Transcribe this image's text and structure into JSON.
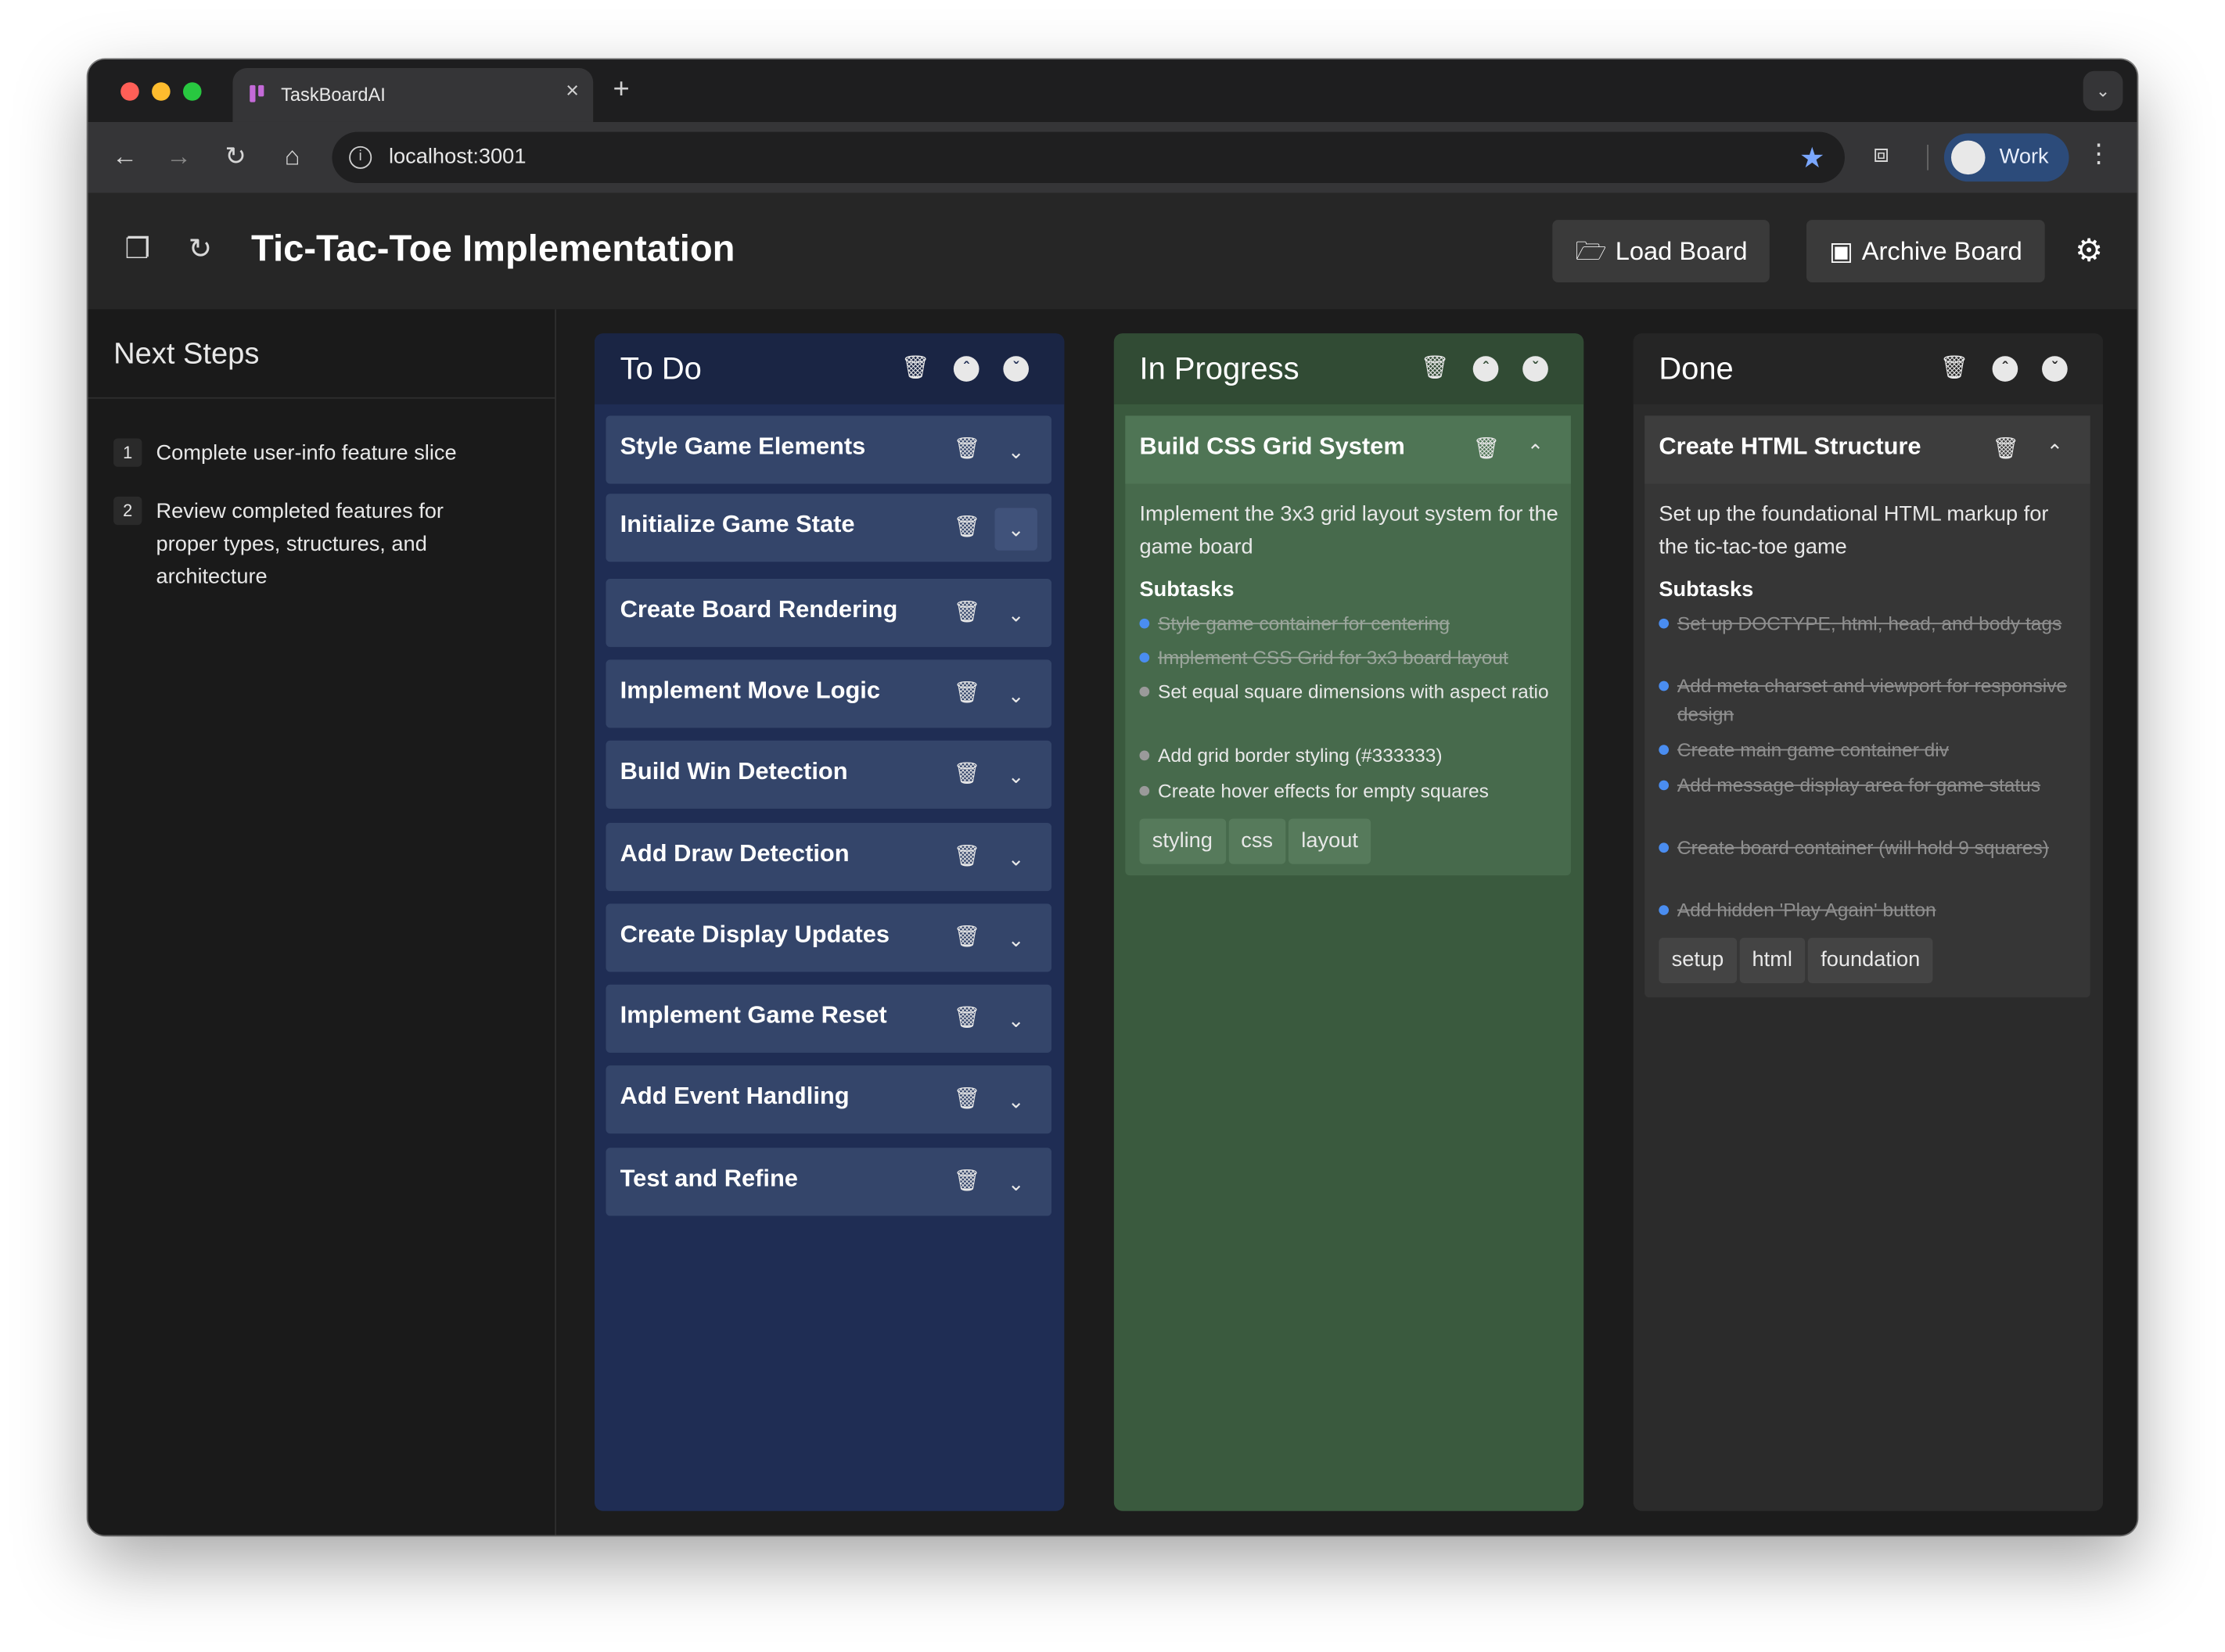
{
  "browser": {
    "tab_title": "TaskBoardAI",
    "new_tab": "+",
    "tab_close": "×",
    "url": "localhost:3001",
    "profile_label": "Work"
  },
  "app": {
    "board_title": "Tic-Tac-Toe Implementation",
    "load_board_label": "Load Board",
    "archive_board_label": "Archive Board"
  },
  "sidebar": {
    "title": "Next Steps",
    "steps": [
      {
        "num": "1",
        "text": "Complete user-info feature slice"
      },
      {
        "num": "2",
        "text": "Review completed features for proper types, structures, and architecture"
      }
    ]
  },
  "columns": {
    "todo": {
      "title": "To Do",
      "cards": [
        "Style Game Elements",
        "Initialize Game State",
        "Create Board Rendering",
        "Implement Move Logic",
        "Build Win Detection",
        "Add Draw Detection",
        "Create Display Updates",
        "Implement Game Reset",
        "Add Event Handling",
        "Test and Refine"
      ]
    },
    "in_progress": {
      "title": "In Progress",
      "card": {
        "title": "Build CSS Grid System",
        "description": "Implement the 3x3 grid layout system for the game board",
        "subtasks_label": "Subtasks",
        "subtasks": [
          {
            "text": "Style game container for centering",
            "done": true
          },
          {
            "text": "Implement CSS Grid for 3x3 board layout",
            "done": true
          },
          {
            "text": "Set equal square dimensions with aspect ratio",
            "done": false
          },
          {
            "text": "Add grid border styling (#333333)",
            "done": false
          },
          {
            "text": "Create hover effects for empty squares",
            "done": false
          }
        ],
        "tags": [
          "styling",
          "css",
          "layout"
        ]
      }
    },
    "done": {
      "title": "Done",
      "card": {
        "title": "Create HTML Structure",
        "description": "Set up the foundational HTML markup for the tic-tac-toe game",
        "subtasks_label": "Subtasks",
        "subtasks": [
          {
            "text": "Set up DOCTYPE, html, head, and body tags",
            "done": true
          },
          {
            "text": "Add meta charset and viewport for responsive design",
            "done": true
          },
          {
            "text": "Create main game container div",
            "done": true
          },
          {
            "text": "Add message display area for game status",
            "done": true
          },
          {
            "text": "Create board container (will hold 9 squares)",
            "done": true
          },
          {
            "text": "Add hidden 'Play Again' button",
            "done": true
          }
        ],
        "tags": [
          "setup",
          "html",
          "foundation"
        ]
      }
    }
  },
  "colors": {
    "todo_column": "#1f2d54",
    "progress_column": "#3a5a3e",
    "done_column": "#2b2b2b",
    "subtask_done_dot": "#4a8df0",
    "subtask_open_dot": "#9a9a9a"
  }
}
